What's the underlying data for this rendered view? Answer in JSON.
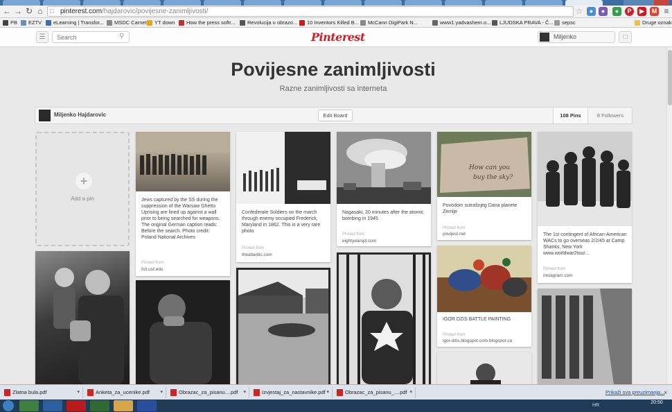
{
  "browser": {
    "url_host": "pinterest.com",
    "url_path": "/hajdarovic/povijesne-zanimljivosti/",
    "bookmarks": [
      {
        "label": "PB",
        "color": "#444"
      },
      {
        "label": "EZTV",
        "color": "#6a8fba"
      },
      {
        "label": "eLearning | Transfor...",
        "color": "#3b6ea8"
      },
      {
        "label": "MSDC Carnet",
        "color": "#888"
      },
      {
        "label": "YT down",
        "color": "#e6a817"
      },
      {
        "label": "How the press softr...",
        "color": "#b33"
      },
      {
        "label": "Revolucija u obrazo...",
        "color": "#555"
      },
      {
        "label": "10 Inventors Killed B...",
        "color": "#cc181e"
      },
      {
        "label": "McCann DigiPark N...",
        "color": "#888"
      },
      {
        "label": "www1.yadvashem.o...",
        "color": "#666"
      },
      {
        "label": "LJUDSKA PRAVA - Č...",
        "color": "#555"
      },
      {
        "label": "sepsc",
        "color": "#999"
      },
      {
        "label": "Druge oznake",
        "color": "#e6c35c"
      }
    ]
  },
  "header": {
    "search_placeholder": "Search",
    "logo": "Pinterest",
    "username": "Miljenko"
  },
  "board": {
    "title": "Povijesne zanimljivosti",
    "description": "Razne zanimljivosti sa interneta",
    "owner": "Miljenko Hajdarovic",
    "edit_label": "Edit Board",
    "pins_count": "108 Pins",
    "followers_count": "8 Followers"
  },
  "add_pin_label": "Add a pin",
  "pins": [
    {
      "desc": "Jews captured by the SS during the suppression of the Warsaw Ghetto Uprising are lined up against a wall prior to being searched for weapons. The original German caption reads: Before the search. Photo credit: Poland National Archives",
      "from_label": "Pinned from",
      "source": "fcit.usf.edu"
    },
    {
      "desc": "Confederate Soldiers on the march through enemy occupied Frederick, Maryland in 1862. This is a very rare photo",
      "from_label": "Pinned from",
      "source": "theatlantic.com"
    },
    {
      "desc": "Nagasaki, 20 minutes after the atomic bombing in 1945",
      "from_label": "Pinned from",
      "source": "eightyearsjd.com"
    },
    {
      "desc": "Povodom sutrašnjeg Dana planete Zemlje",
      "from_label": "Pinned from",
      "source": "povijest.net"
    },
    {
      "desc": "The 1st contingent of African-American WACs to go overseas 2/2/45 at Camp Shanks, New York www.worldwar2tour...",
      "from_label": "Pinned from",
      "source": "instagram.com"
    },
    {
      "desc": "IGOR DZIS BATTLE PAINTING",
      "from_label": "Pinned from",
      "source": "igor-dzis.blogspot.com.blogspot.ca"
    }
  ],
  "pin_image_text": {
    "sky": "How can you buy the sky?"
  },
  "downloads": [
    {
      "name": "Zlatna bula.pdf"
    },
    {
      "name": "Anketa_za_ucenike.pdf"
    },
    {
      "name": "Obrazac_za_pisanu....pdf"
    },
    {
      "name": "Izvjestaj_za_nastavnike.pdf"
    },
    {
      "name": "Obrazac_za_pisanu_....pdf"
    }
  ],
  "downloads_show_all": "Prikaži sva preuzimanja...",
  "taskbar": {
    "time": "20:50",
    "lang": "HR"
  },
  "colors": {
    "brand": "#cb2027",
    "background": "#e9e9e9"
  }
}
